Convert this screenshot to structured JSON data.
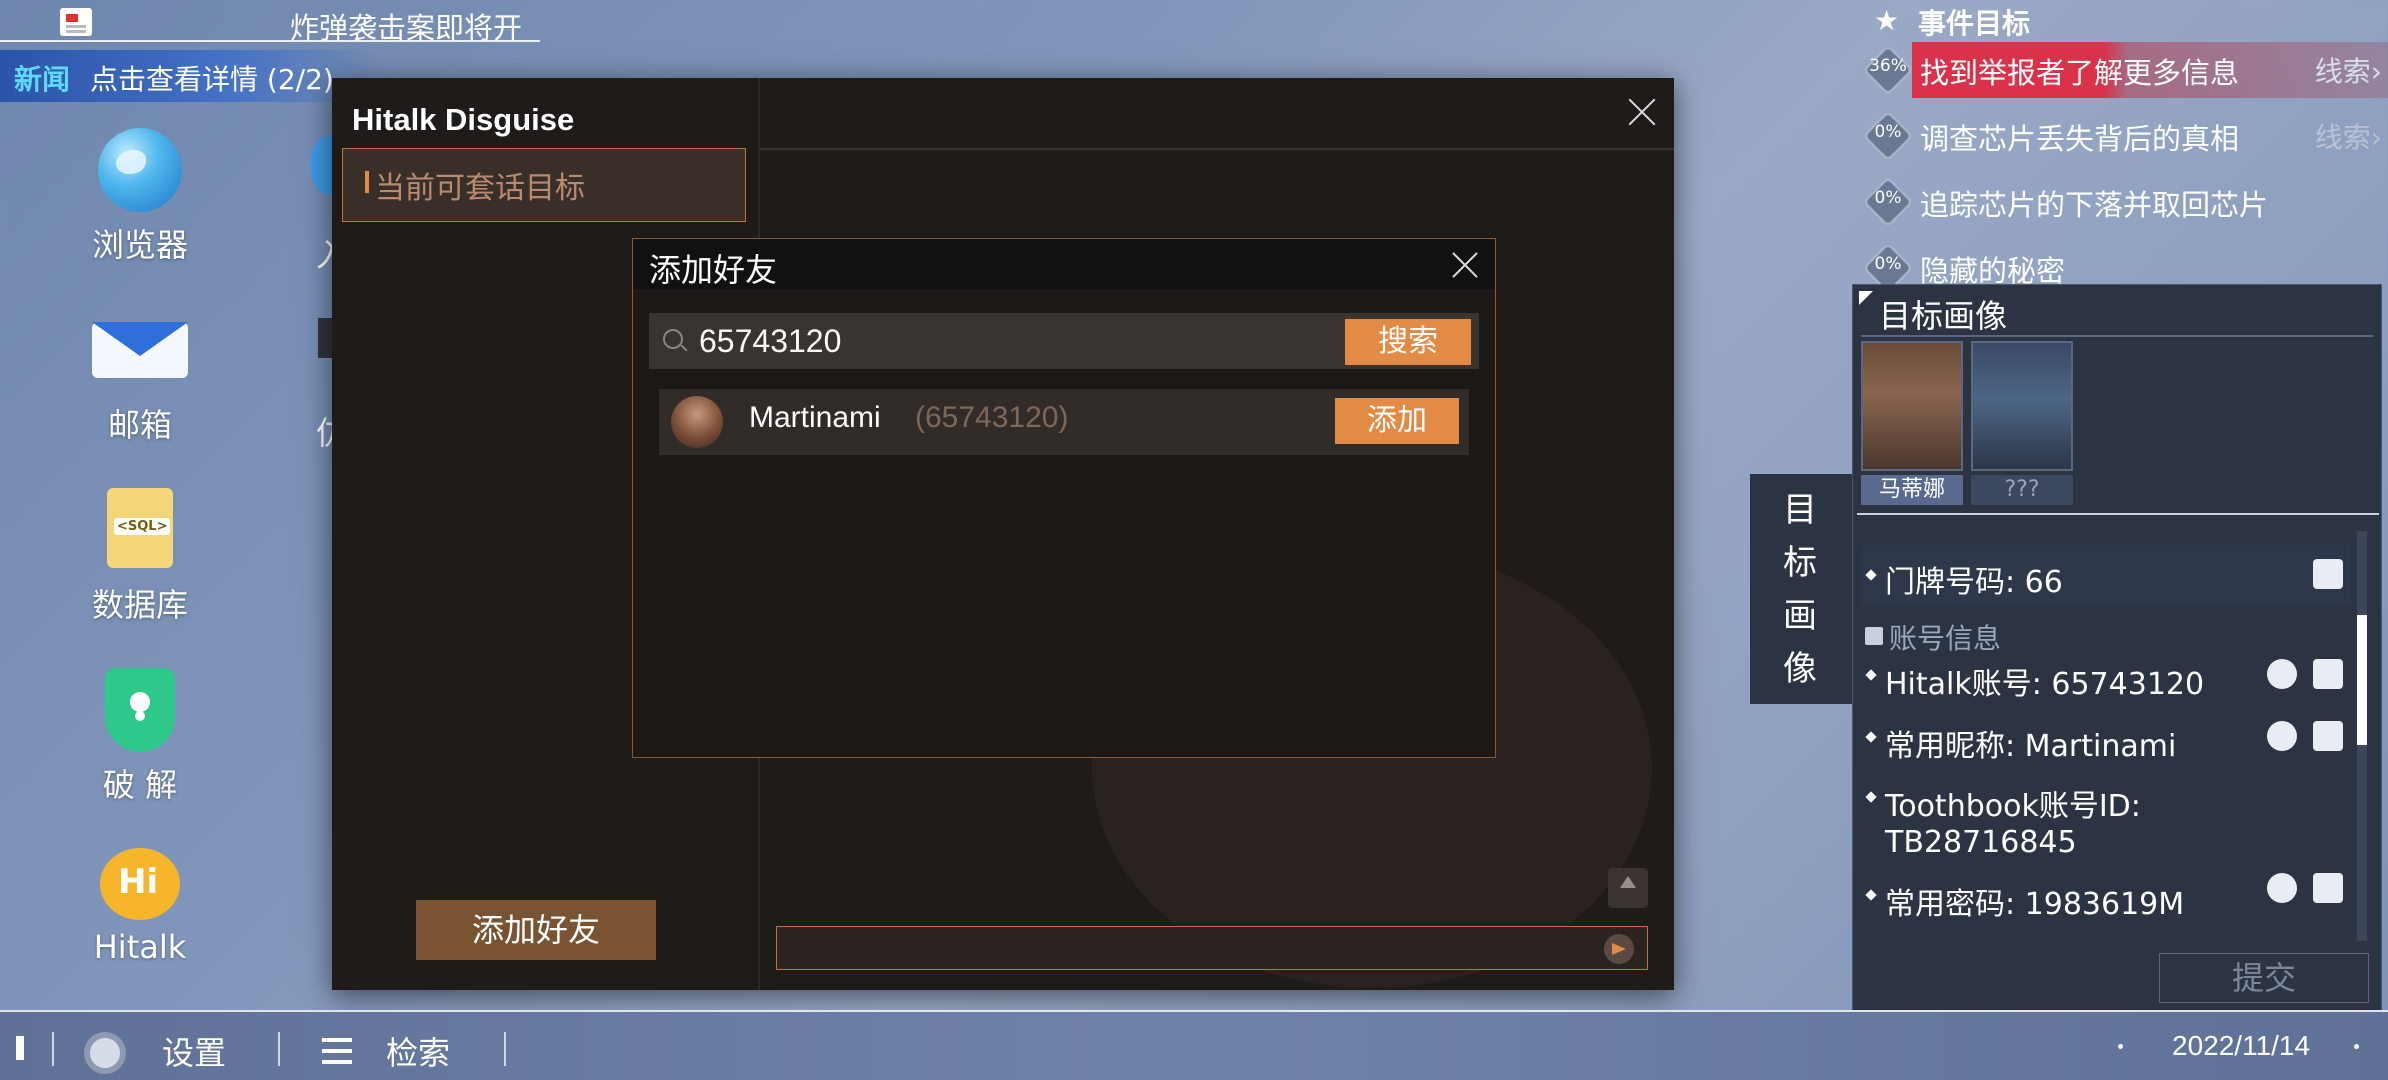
{
  "news": {
    "headline": "炸弹袭击案即将开",
    "tag": "新闻",
    "text": "点击查看详情 (2/2)"
  },
  "desktop": {
    "icons": [
      {
        "label": "浏览器",
        "icon": "globe-icon"
      },
      {
        "label": "邮箱",
        "icon": "mail-icon"
      },
      {
        "label": "数据库",
        "icon": "sql-file-icon"
      },
      {
        "label": "破 解",
        "icon": "shield-key-icon"
      },
      {
        "label": "Hitalk",
        "icon": "hitalk-icon"
      }
    ],
    "col2_label_a": "入",
    "col2_label_b": "仿"
  },
  "hitalk": {
    "title": "Hitalk Disguise",
    "target_tab_label": "当前可套话目标",
    "add_friend_button": "添加好友",
    "chat_input_value": ""
  },
  "dialog": {
    "title": "添加好友",
    "search_value": "65743120",
    "search_button": "搜索",
    "result": {
      "name": "Martinami",
      "id": "(65743120)",
      "add_button": "添加"
    }
  },
  "goals": {
    "title": "事件目标",
    "items": [
      {
        "pct": "36%",
        "label": "找到举报者了解更多信息",
        "clue": "线索›"
      },
      {
        "pct": "0%",
        "label": "调查芯片丢失背后的真相",
        "clue": "线索›"
      },
      {
        "pct": "0%",
        "label": "追踪芯片的下落并取回芯片",
        "clue": ""
      },
      {
        "pct": "0%",
        "label": "隐藏的秘密",
        "clue": ""
      }
    ]
  },
  "profile": {
    "title": "目标画像",
    "side_tab": "目标画像",
    "portraits": [
      {
        "label": "马蒂娜"
      },
      {
        "label": "???"
      }
    ],
    "door": "门牌号码: 66",
    "section": "账号信息",
    "hitalk_account": "Hitalk账号: 65743120",
    "nickname": "常用昵称: Martinami",
    "toothbook_line1": "Toothbook账号ID:",
    "toothbook_line2": "TB28716845",
    "password": "常用密码: 1983619M",
    "submit": "提交"
  },
  "taskbar": {
    "settings": "设置",
    "search": "检索",
    "date": "2022/11/14"
  },
  "colors": {
    "accent": "#e38a44",
    "goal_highlight": "#d9324a",
    "panel": "#2c3444",
    "window_bg": "#1e1b19"
  }
}
